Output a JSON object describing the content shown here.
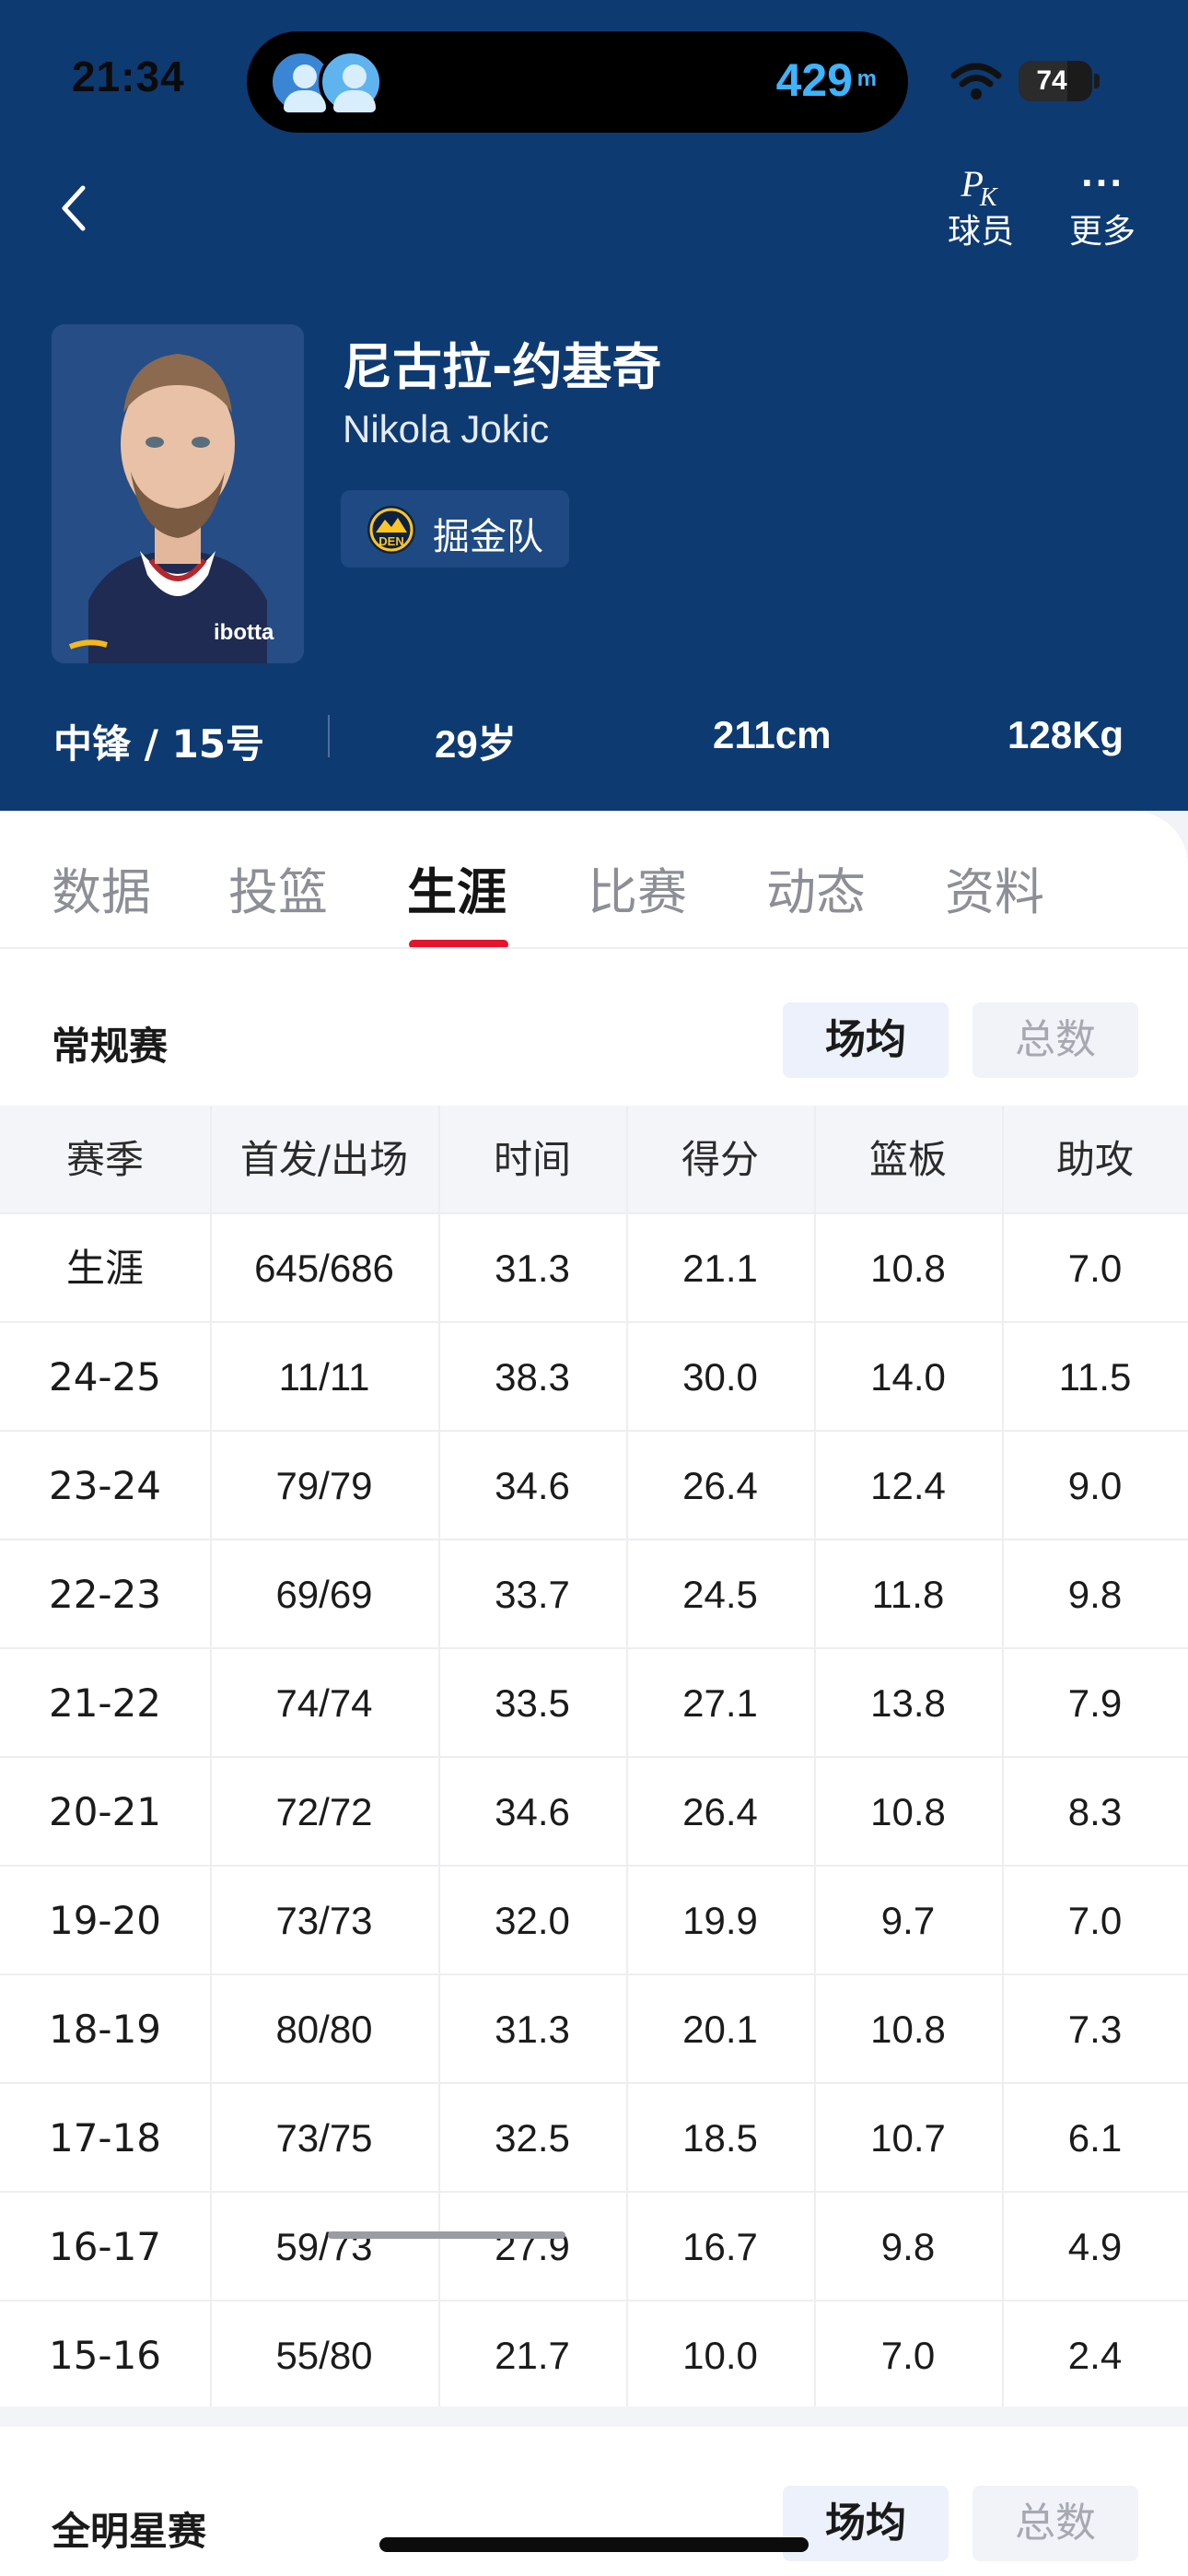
{
  "status_bar": {
    "time": "21:34",
    "island_distance": "429",
    "island_unit": "m",
    "battery": "74",
    "battery_level": 0.74
  },
  "nav": {
    "pk_label": "球员",
    "more_label": "更多",
    "pk_glyph_p": "P",
    "pk_glyph_k": "K",
    "more_glyph": "···"
  },
  "player": {
    "name_cn": "尼古拉-约基奇",
    "name_en": "Nikola Jokic",
    "team": "掘金队",
    "team_logo_text": "DEN",
    "photo_jersey_text": "ibotta",
    "position_number": "中锋 / 15号",
    "age": "29岁",
    "height": "211cm",
    "weight": "128Kg"
  },
  "tabs": [
    "数据",
    "投篮",
    "生涯",
    "比赛",
    "动态",
    "资料"
  ],
  "active_tab": "生涯",
  "regular_season": {
    "title": "常规赛",
    "toggle_avg": "场均",
    "toggle_total": "总数",
    "columns": [
      "赛季",
      "首发/出场",
      "时间",
      "得分",
      "篮板",
      "助攻"
    ],
    "rows": [
      [
        "生涯",
        "645/686",
        "31.3",
        "21.1",
        "10.8",
        "7.0"
      ],
      [
        "24-25",
        "11/11",
        "38.3",
        "30.0",
        "14.0",
        "11.5"
      ],
      [
        "23-24",
        "79/79",
        "34.6",
        "26.4",
        "12.4",
        "9.0"
      ],
      [
        "22-23",
        "69/69",
        "33.7",
        "24.5",
        "11.8",
        "9.8"
      ],
      [
        "21-22",
        "74/74",
        "33.5",
        "27.1",
        "13.8",
        "7.9"
      ],
      [
        "20-21",
        "72/72",
        "34.6",
        "26.4",
        "10.8",
        "8.3"
      ],
      [
        "19-20",
        "73/73",
        "32.0",
        "19.9",
        "9.7",
        "7.0"
      ],
      [
        "18-19",
        "80/80",
        "31.3",
        "20.1",
        "10.8",
        "7.3"
      ],
      [
        "17-18",
        "73/75",
        "32.5",
        "18.5",
        "10.7",
        "6.1"
      ],
      [
        "16-17",
        "59/73",
        "27.9",
        "16.7",
        "9.8",
        "4.9"
      ],
      [
        "15-16",
        "55/80",
        "21.7",
        "10.0",
        "7.0",
        "2.4"
      ]
    ]
  },
  "all_star": {
    "title": "全明星赛",
    "toggle_avg": "场均",
    "toggle_total": "总数"
  },
  "colors": {
    "header_bg": "#0e3a72",
    "accent_red": "#e4142d",
    "island_text": "#3cb4ff"
  }
}
